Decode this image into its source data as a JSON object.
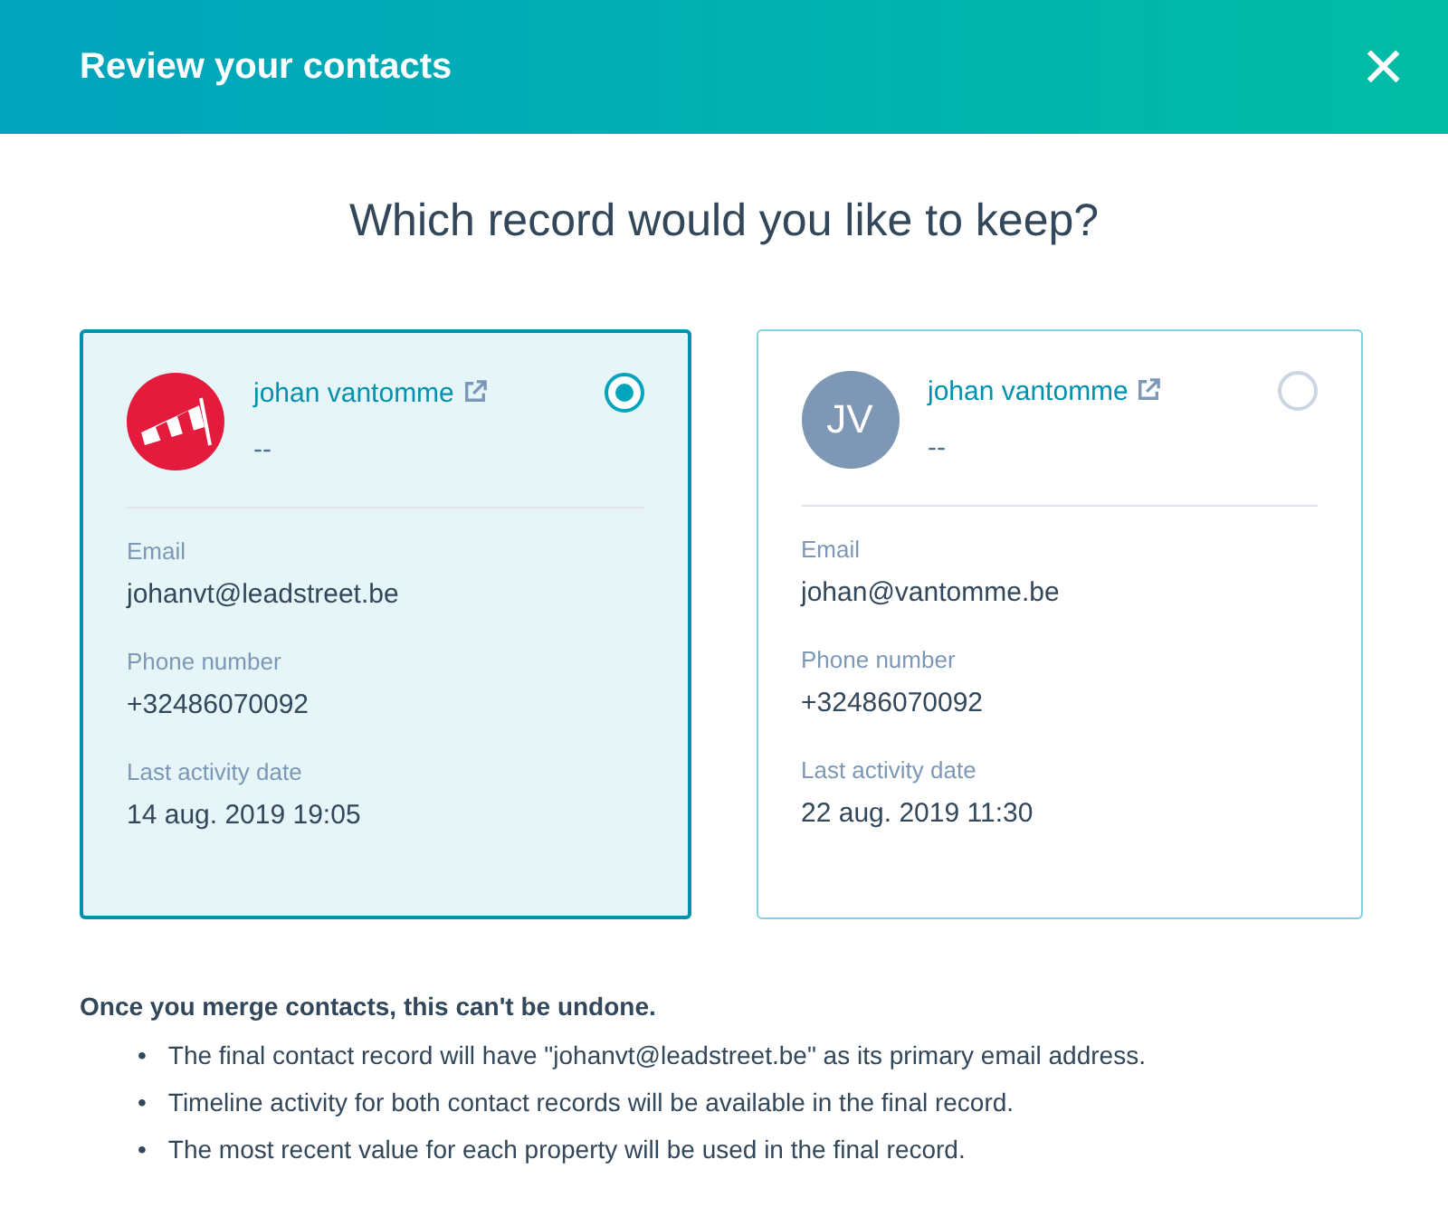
{
  "header": {
    "title": "Review your contacts",
    "close": "×"
  },
  "question": "Which record would you like to keep?",
  "records": [
    {
      "selected": true,
      "avatar": {
        "kind": "logo"
      },
      "name": "johan vantomme",
      "subtitle": "--",
      "fields": [
        {
          "label": "Email",
          "value": "johanvt@leadstreet.be"
        },
        {
          "label": "Phone number",
          "value": "+32486070092"
        },
        {
          "label": "Last activity date",
          "value": "14 aug. 2019 19:05"
        }
      ]
    },
    {
      "selected": false,
      "avatar": {
        "kind": "initials",
        "text": "JV"
      },
      "name": "johan vantomme",
      "subtitle": "--",
      "fields": [
        {
          "label": "Email",
          "value": "johan@vantomme.be"
        },
        {
          "label": "Phone number",
          "value": "+32486070092"
        },
        {
          "label": "Last activity date",
          "value": "22 aug. 2019 11:30"
        }
      ]
    }
  ],
  "warning": {
    "title": "Once you merge contacts, this can't be undone.",
    "items": [
      {
        "bullet": "•",
        "text": "The final contact record will have \"johanvt@leadstreet.be\" as its primary email address."
      },
      {
        "bullet": "•",
        "text": "Timeline activity for both contact records will be available in the final record."
      },
      {
        "bullet": "•",
        "text": "The most recent value for each property will be used in the final record."
      }
    ]
  }
}
